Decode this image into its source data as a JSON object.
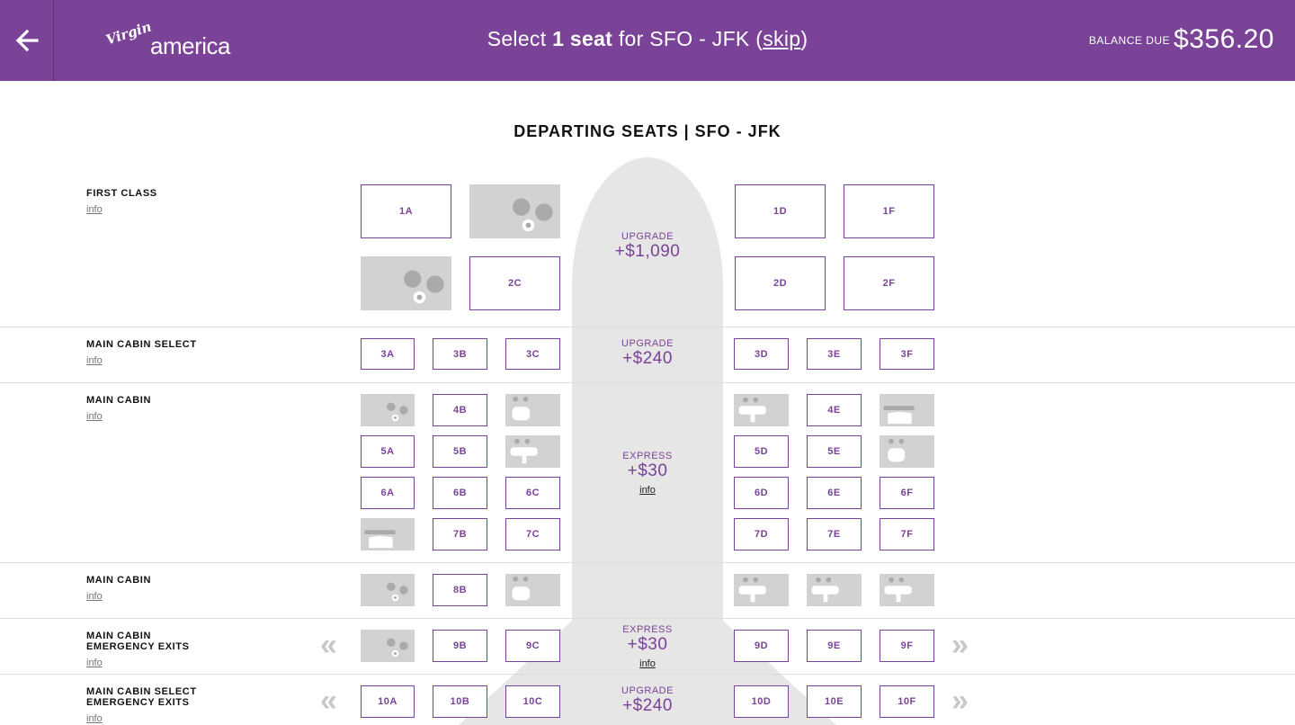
{
  "header": {
    "logo_script": "Virgin",
    "logo_word": "america",
    "title_pre": "Select ",
    "title_bold": "1 seat",
    "title_mid": " for SFO - JFK (",
    "title_skip": "skip",
    "title_post": ")",
    "balance_label": "BALANCE DUE",
    "balance_amount": "$356.20"
  },
  "section_title": "DEPARTING SEATS | SFO - JFK",
  "rows": [
    {
      "name": "FIRST CLASS",
      "info": "info"
    },
    {
      "name": "MAIN CABIN SELECT",
      "info": "info"
    },
    {
      "name": "MAIN CABIN",
      "info": "info"
    },
    {
      "name": "MAIN CABIN",
      "info": "info"
    },
    {
      "name_line1": "MAIN CABIN",
      "name_line2": "EMERGENCY EXITS",
      "info": "info"
    },
    {
      "name_line1": "MAIN CABIN SELECT",
      "name_line2": "EMERGENCY EXITS",
      "info": "info"
    }
  ],
  "prices": [
    {
      "kind": "UPGRADE",
      "amount": "+$1,090"
    },
    {
      "kind": "UPGRADE",
      "amount": "+$240"
    },
    {
      "kind": "EXPRESS",
      "amount": "+$30",
      "info": "info"
    },
    {
      "kind": "EXPRESS",
      "amount": "+$30",
      "info": "info"
    },
    {
      "kind": "UPGRADE",
      "amount": "+$240"
    }
  ],
  "seats": {
    "1A": "1A",
    "1D": "1D",
    "1F": "1F",
    "2C": "2C",
    "2D": "2D",
    "2F": "2F",
    "3A": "3A",
    "3B": "3B",
    "3C": "3C",
    "3D": "3D",
    "3E": "3E",
    "3F": "3F",
    "4B": "4B",
    "4E": "4E",
    "5A": "5A",
    "5B": "5B",
    "5D": "5D",
    "5E": "5E",
    "6A": "6A",
    "6B": "6B",
    "6C": "6C",
    "6D": "6D",
    "6E": "6E",
    "6F": "6F",
    "7B": "7B",
    "7C": "7C",
    "7D": "7D",
    "7E": "7E",
    "7F": "7F",
    "8B": "8B",
    "9B": "9B",
    "9C": "9C",
    "9D": "9D",
    "9E": "9E",
    "9F": "9F",
    "10A": "10A",
    "10B": "10B",
    "10C": "10C",
    "10D": "10D",
    "10E": "10E",
    "10F": "10F"
  },
  "occupied_seats": [
    "1C",
    "2A",
    "4A",
    "4C",
    "4D",
    "4F",
    "5C",
    "5F",
    "7A",
    "8A",
    "8C",
    "8D",
    "8E",
    "8F",
    "9A"
  ],
  "icons": {
    "back": "arrow-left-icon",
    "chevron_left": "double-chevron-left-icon",
    "chevron_right": "double-chevron-right-icon",
    "chevron_left_glyph": "«",
    "chevron_right_glyph": "»"
  },
  "colors": {
    "brand": "#7b4397",
    "occupied": "#d2d2d2",
    "plane": "#e6e6e6"
  }
}
